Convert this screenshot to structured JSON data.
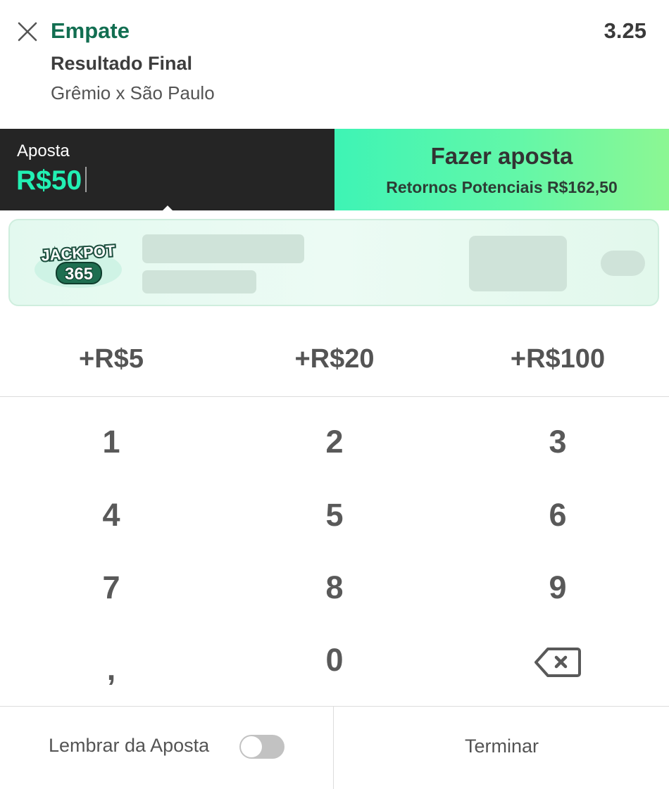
{
  "selection": {
    "name": "Empate",
    "odds": "3.25",
    "market": "Resultado Final",
    "fixture": "Grêmio x São Paulo",
    "close_icon": "close-icon"
  },
  "stake": {
    "label": "Aposta",
    "value": "R$50"
  },
  "place_bet": {
    "title": "Fazer aposta",
    "returns": "Retornos Potenciais R$162,50"
  },
  "jackpot": {
    "logo_text_top": "JACKPOT",
    "logo_text_bottom": "365"
  },
  "quick_stakes": [
    "+R$5",
    "+R$20",
    "+R$100"
  ],
  "keypad": {
    "keys": [
      "1",
      "2",
      "3",
      "4",
      "5",
      "6",
      "7",
      "8",
      "9",
      ",",
      "0"
    ],
    "backspace_icon": "backspace-icon"
  },
  "footer": {
    "remember_label": "Lembrar da Aposta",
    "remember_enabled": false,
    "finish_label": "Terminar"
  },
  "colors": {
    "selection_green": "#126e51",
    "stake_accent": "#22f0b3",
    "stake_bg": "#252525",
    "cta_gradient_start": "#3ef4b5",
    "cta_gradient_end": "#8cf793"
  }
}
